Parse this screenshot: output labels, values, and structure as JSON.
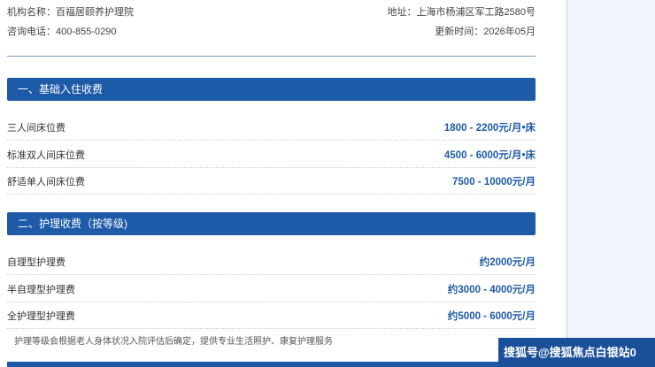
{
  "header": {
    "org_name": "机构名称：百福居颐养护理院",
    "address": "地址：上海市杨浦区军工路2580号",
    "phone": "咨询电话：400-855-0290",
    "updated": "更新时间：2026年05月"
  },
  "sections": [
    {
      "title": "一、基础入住收费",
      "rows": [
        {
          "name": "三人间床位费",
          "price": "1800 - 2200元/月•床"
        },
        {
          "name": "标准双人间床位费",
          "price": "4500 - 6000元/月•床"
        },
        {
          "name": "舒适单人间床位费",
          "price": "7500 - 10000元/月"
        }
      ]
    },
    {
      "title": "二、护理收费（按等级)",
      "rows": [
        {
          "name": "自理型护理费",
          "price": "约2000元/月"
        },
        {
          "name": "半自理型护理费",
          "price": "约3000 - 4000元/月"
        },
        {
          "name": "全护理型护理费",
          "price": "约5000 - 6000元/月"
        }
      ]
    }
  ],
  "note": "护理等级会根据老人身体状况入院评估后确定，提供专业生活照护、康复护理服务",
  "watermark": "搜狐号@搜狐焦点白银站0"
}
